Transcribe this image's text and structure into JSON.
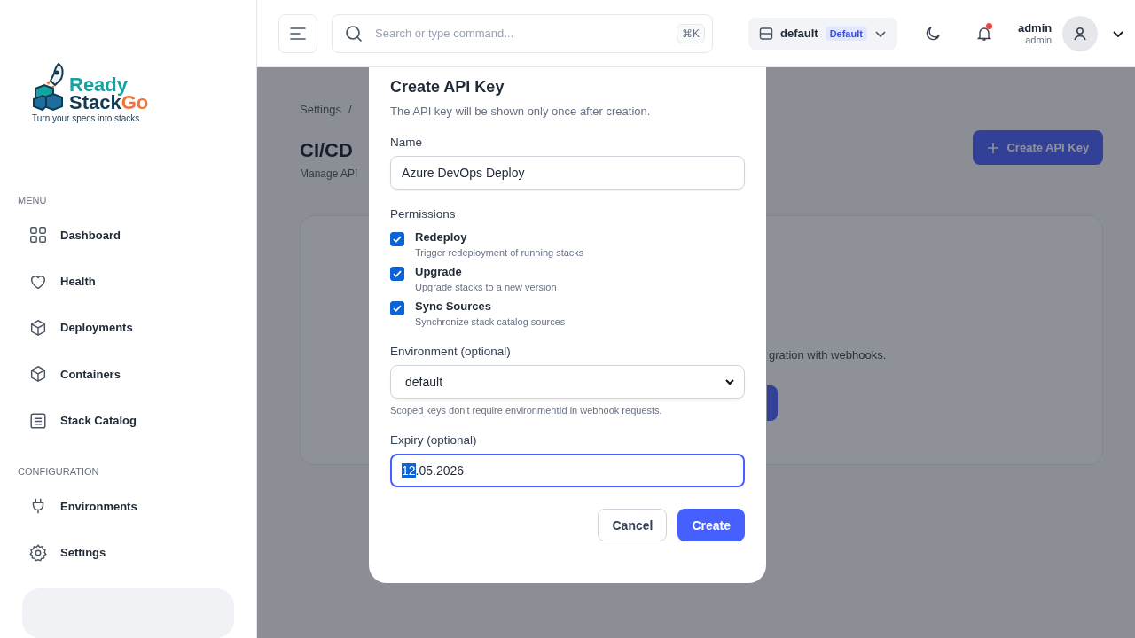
{
  "logo": {
    "line1": "Ready",
    "line2a": "Stack",
    "line2b": "Go",
    "tagline": "Turn your specs into stacks"
  },
  "sidebar": {
    "sections": [
      {
        "title": "MENU",
        "items": [
          {
            "label": "Dashboard"
          },
          {
            "label": "Health"
          },
          {
            "label": "Deployments"
          },
          {
            "label": "Containers"
          },
          {
            "label": "Stack Catalog"
          }
        ]
      },
      {
        "title": "CONFIGURATION",
        "items": [
          {
            "label": "Environments"
          },
          {
            "label": "Settings"
          }
        ]
      }
    ]
  },
  "header": {
    "search": {
      "placeholder": "Search or type command...",
      "shortcut": "⌘K"
    },
    "environment": {
      "name": "default",
      "badge": "Default"
    },
    "notifications": {
      "unread": true
    },
    "user": {
      "name": "admin",
      "role": "admin"
    }
  },
  "page": {
    "breadcrumb": [
      "Settings",
      "/"
    ],
    "title": "CI/CD",
    "subtitle": "Manage API",
    "create_button": "Create API Key",
    "card_text": "gration with webhooks."
  },
  "dialog": {
    "title": "Create API Key",
    "subtitle": "The API key will be shown only once after creation.",
    "name": {
      "label": "Name",
      "value": "Azure DevOps Deploy"
    },
    "permissions": {
      "label": "Permissions",
      "items": [
        {
          "label": "Redeploy",
          "description": "Trigger redeployment of running stacks",
          "checked": true
        },
        {
          "label": "Upgrade",
          "description": "Upgrade stacks to a new version",
          "checked": true
        },
        {
          "label": "Sync Sources",
          "description": "Synchronize stack catalog sources",
          "checked": true
        }
      ]
    },
    "environment": {
      "label": "Environment (optional)",
      "value": "default",
      "hint": "Scoped keys don't require environmentId in webhook requests."
    },
    "expiry": {
      "label": "Expiry (optional)",
      "value_selected": "12",
      "value_rest": ".05.2026",
      "focused": true
    },
    "buttons": [
      {
        "label": "Cancel",
        "kind": "secondary"
      },
      {
        "label": "Create",
        "kind": "primary"
      }
    ]
  }
}
